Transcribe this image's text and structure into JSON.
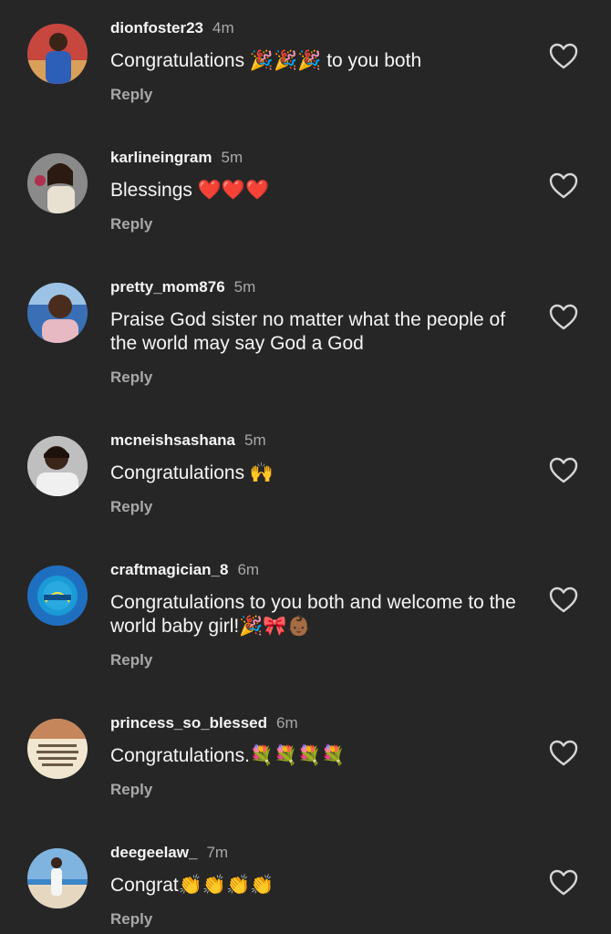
{
  "comments": [
    {
      "username": "dionfoster23",
      "time": "4m",
      "text": "Congratulations 🎉🎉🎉 to you both",
      "reply": "Reply",
      "avatar": "avatar-woman-blue-dress"
    },
    {
      "username": "karlineingram",
      "time": "5m",
      "text": "Blessings ❤️❤️❤️",
      "reply": "Reply",
      "avatar": "avatar-woman-flower"
    },
    {
      "username": "pretty_mom876",
      "time": "5m",
      "text": "Praise God sister no matter  what the people of the world may say God a God",
      "reply": "Reply",
      "avatar": "avatar-woman-smiling"
    },
    {
      "username": "mcneishsashana",
      "time": "5m",
      "text": "Congratulations 🙌",
      "reply": "Reply",
      "avatar": "avatar-woman-selfie"
    },
    {
      "username": "craftmagician_8",
      "time": "6m",
      "text": "Congratulations to you both and welcome to the world baby girl!🎉🎀👶🏾",
      "reply": "Reply",
      "avatar": "avatar-craft-logo"
    },
    {
      "username": "princess_so_blessed",
      "time": "6m",
      "text": "Congratulations.💐💐💐💐",
      "reply": "Reply",
      "avatar": "avatar-scripture-text"
    },
    {
      "username": "deegeelaw_",
      "time": "7m",
      "text": "Congrat👏👏👏👏",
      "reply": "Reply",
      "avatar": "avatar-beach-person"
    }
  ],
  "icons": {
    "like": "heart-outline-icon"
  },
  "colors": {
    "background": "#262626",
    "primary_text": "#f5f5f5",
    "secondary_text": "#a8a8a8"
  }
}
